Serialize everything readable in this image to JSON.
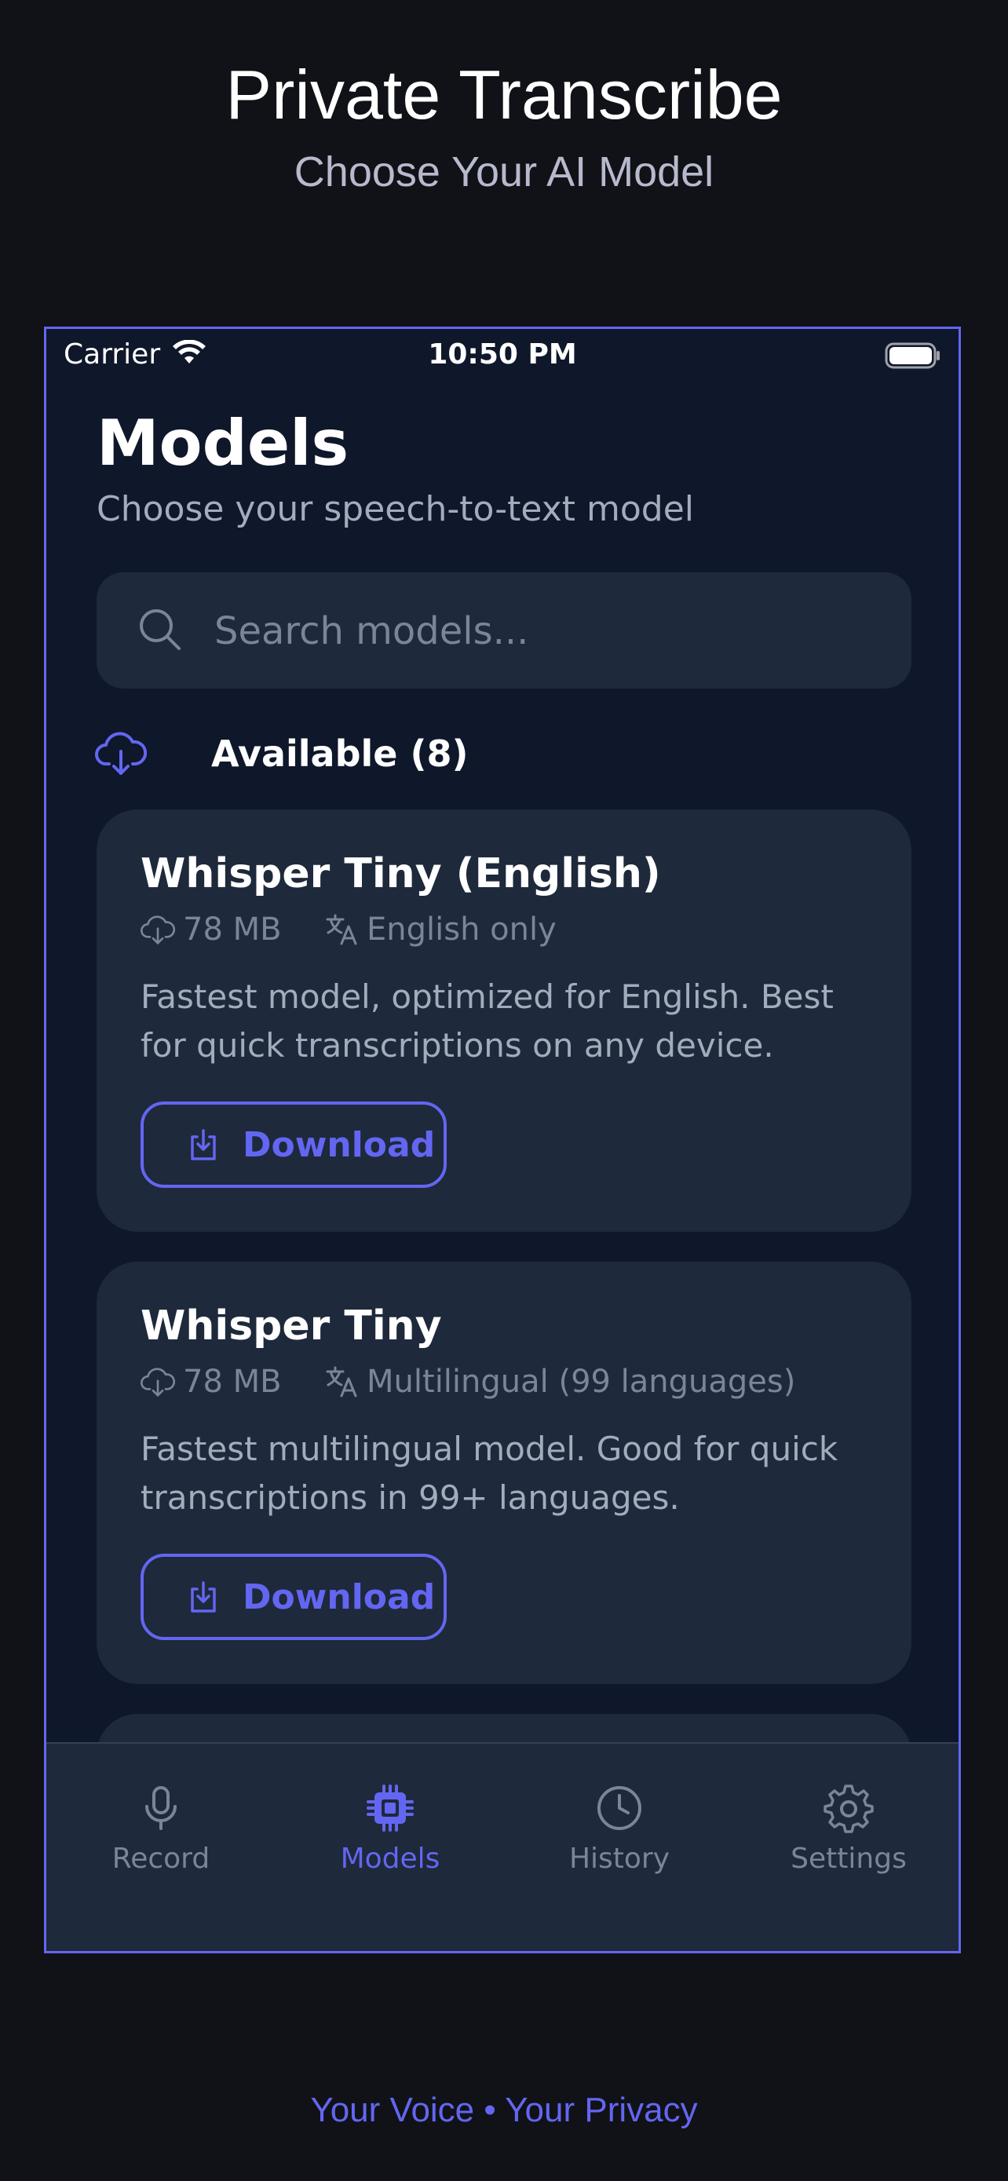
{
  "promo": {
    "title": "Private Transcribe",
    "subtitle": "Choose Your AI Model",
    "footer": "Your Voice • Your Privacy"
  },
  "status_bar": {
    "carrier": "Carrier",
    "time": "10:50 PM"
  },
  "page": {
    "title": "Models",
    "subtitle": "Choose your speech-to-text model"
  },
  "search": {
    "placeholder": "Search models..."
  },
  "section": {
    "label": "Available (8)"
  },
  "models": [
    {
      "name": "Whisper Tiny (English)",
      "size": "78 MB",
      "language": "English only",
      "description": "Fastest model, optimized for English. Best for quick transcriptions on any device.",
      "action": "Download"
    },
    {
      "name": "Whisper Tiny",
      "size": "78 MB",
      "language": "Multilingual (99 languages)",
      "description": "Fastest multilingual model. Good for quick transcriptions in 99+ languages.",
      "action": "Download"
    }
  ],
  "tabs": [
    {
      "label": "Record",
      "icon": "microphone-icon",
      "active": false
    },
    {
      "label": "Models",
      "icon": "chip-icon",
      "active": true
    },
    {
      "label": "History",
      "icon": "clock-icon",
      "active": false
    },
    {
      "label": "Settings",
      "icon": "gear-icon",
      "active": false
    }
  ],
  "colors": {
    "accent": "#6366f1",
    "background": "#0f172a",
    "card": "#1e293b",
    "outer_background": "#111217"
  }
}
